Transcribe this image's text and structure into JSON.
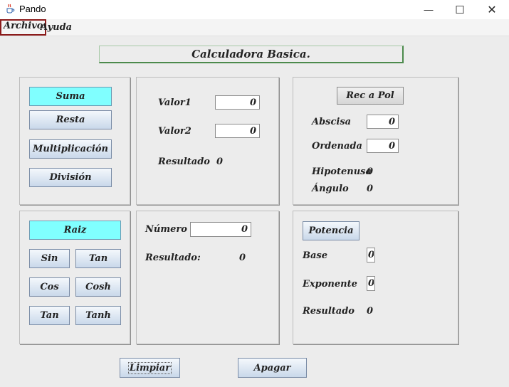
{
  "window": {
    "title": "Pando",
    "minimize_glyph": "—",
    "maximize_glyph": "☐",
    "close_glyph": "✕"
  },
  "menubar": {
    "items": [
      {
        "label": "Archivo"
      },
      {
        "label": "Ayuda"
      }
    ]
  },
  "header": {
    "title": "Calculadora Basica."
  },
  "basic_ops": {
    "buttons": [
      "Suma",
      "Resta",
      "Multiplicación",
      "División"
    ]
  },
  "calc": {
    "valor1_label": "Valor1",
    "valor1_value": "0",
    "valor2_label": "Valor2",
    "valor2_value": "0",
    "resultado_label": "Resultado",
    "resultado_value": "0"
  },
  "rec_pol": {
    "button": "Rec a Pol",
    "abscisa_label": "Abscisa",
    "abscisa_value": "0",
    "ordenada_label": "Ordenada",
    "ordenada_value": "0",
    "hipotenusa_label": "Hipotenusa",
    "hipotenusa_value": "0",
    "angulo_label": "Ángulo",
    "angulo_value": "0"
  },
  "trig": {
    "raiz": "Raiz",
    "buttons": [
      "Sin",
      "Tan",
      "Cos",
      "Cosh",
      "Tan",
      "Tanh"
    ]
  },
  "numero": {
    "numero_label": "Número",
    "numero_value": "0",
    "resultado_label": "Resultado:",
    "resultado_value": "0"
  },
  "potencia": {
    "button": "Potencia",
    "base_label": "Base",
    "base_value": "0",
    "exponente_label": "Exponente",
    "exponente_value": "0",
    "resultado_label": "Resultado",
    "resultado_value": "0"
  },
  "footer": {
    "limpiar": "Limpiar",
    "apagar": "Apagar"
  },
  "colors": {
    "accent_cyan": "#80ffff",
    "focus_border": "#8b1a1a",
    "title_border": "#4c8a4c"
  },
  "icons": [
    "java-cup-icon"
  ]
}
